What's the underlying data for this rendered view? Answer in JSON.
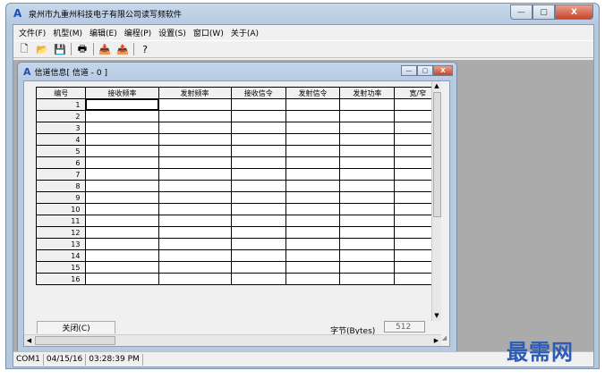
{
  "app": {
    "title": "泉州市九重州科技电子有限公司读写频软件",
    "logo_glyph": "A"
  },
  "window_controls": {
    "minimize": "—",
    "maximize": "▢",
    "close": "X"
  },
  "menubar": [
    "文件(F)",
    "机型(M)",
    "编辑(E)",
    "编程(P)",
    "设置(S)",
    "窗口(W)",
    "关于(A)"
  ],
  "toolbar": [
    {
      "name": "new-file-icon",
      "glyph": "🗋"
    },
    {
      "name": "open-folder-icon",
      "glyph": "📂"
    },
    {
      "name": "save-icon",
      "glyph": "💾"
    },
    {
      "name": "print-icon",
      "glyph": "🖶"
    },
    {
      "name": "read-radio-icon",
      "glyph": "📥"
    },
    {
      "name": "write-radio-icon",
      "glyph": "📤"
    },
    {
      "name": "help-icon",
      "glyph": "?"
    }
  ],
  "child": {
    "title": "信道信息[ 信道 - 0 ]",
    "columns": [
      "编号",
      "接收频率",
      "发射频率",
      "接收信令",
      "发射信令",
      "发射功率",
      "宽/窄"
    ],
    "rows": [
      "1",
      "2",
      "3",
      "4",
      "5",
      "6",
      "7",
      "8",
      "9",
      "10",
      "11",
      "12",
      "13",
      "14",
      "15",
      "16"
    ],
    "close_button": "关闭(C)",
    "bytes_label": "字节(Bytes)",
    "bytes_value": "512"
  },
  "status": {
    "port": "COM1",
    "date": "04/15/16",
    "time": "03:28:39 PM"
  },
  "watermark": "最需网",
  "colors": {
    "accent": "#1e4fb2",
    "mdi_background": "#ababab",
    "close_red": "#c7452c"
  }
}
